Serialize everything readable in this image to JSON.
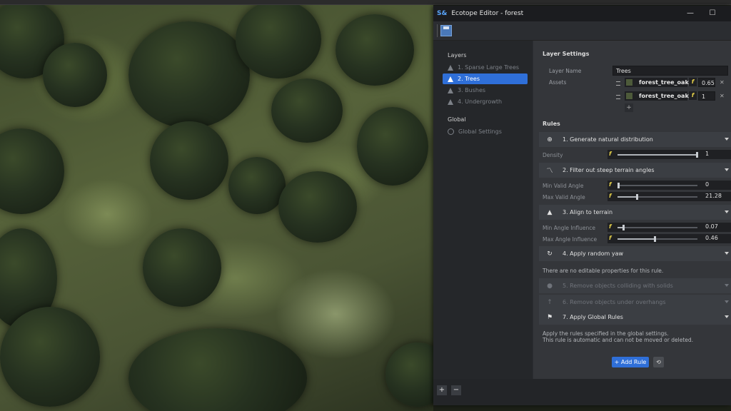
{
  "window": {
    "logo": "S&",
    "title": "Ecotope Editor - forest",
    "minimize": "—",
    "maximize": "☐"
  },
  "toolbar": {
    "save_icon": "floppy-disk-icon"
  },
  "layers": {
    "header": "Layers",
    "items": [
      {
        "label": "1. Sparse Large Trees",
        "selected": false
      },
      {
        "label": "2. Trees",
        "selected": true
      },
      {
        "label": "3. Bushes",
        "selected": false
      },
      {
        "label": "4. Undergrowth",
        "selected": false
      }
    ],
    "global_header": "Global",
    "global_item": "Global Settings"
  },
  "layer_settings": {
    "title": "Layer Settings",
    "name_label": "Layer Name",
    "name_value": "Trees",
    "assets_label": "Assets",
    "assets": [
      {
        "name": "forest_tree_oak_",
        "weight": "0.65"
      },
      {
        "name": "forest_tree_oak_",
        "weight": "1"
      }
    ],
    "add_asset": "+"
  },
  "rules": {
    "title": "Rules",
    "items": [
      {
        "label": "1. Generate natural distribution",
        "icon": "plus-circle-icon"
      },
      {
        "label": "2. Filter out steep terrain angles",
        "icon": "trend-line-icon"
      },
      {
        "label": "3. Align to terrain",
        "icon": "mountain-icon"
      },
      {
        "label": "4. Apply random yaw",
        "icon": "rotate-icon"
      },
      {
        "label": "5. Remove objects colliding with solids",
        "icon": "circle-icon"
      },
      {
        "label": "6. Remove objects under overhangs",
        "icon": "arrow-up-icon"
      },
      {
        "label": "7. Apply Global Rules",
        "icon": "flag-icon"
      }
    ],
    "props": {
      "density": {
        "label": "Density",
        "value": "1",
        "fraction": 1.0
      },
      "min_valid_angle": {
        "label": "Min Valid Angle",
        "value": "0",
        "fraction": 0.0
      },
      "max_valid_angle": {
        "label": "Max Valid Angle",
        "value": "21.28",
        "fraction": 0.24
      },
      "min_angle_influence": {
        "label": "Min Angle Influence",
        "value": "0.07",
        "fraction": 0.07
      },
      "max_angle_influence": {
        "label": "Max Angle Influence",
        "value": "0.46",
        "fraction": 0.46
      }
    },
    "yaw_note": "There are no editable properties for this rule.",
    "global_note_1": "Apply the rules specified in the global settings.",
    "global_note_2": "This rule is automatic and can not be moved or deleted.",
    "add_rule": "+ Add Rule"
  },
  "bottombar": {
    "add": "+",
    "remove": "−"
  }
}
